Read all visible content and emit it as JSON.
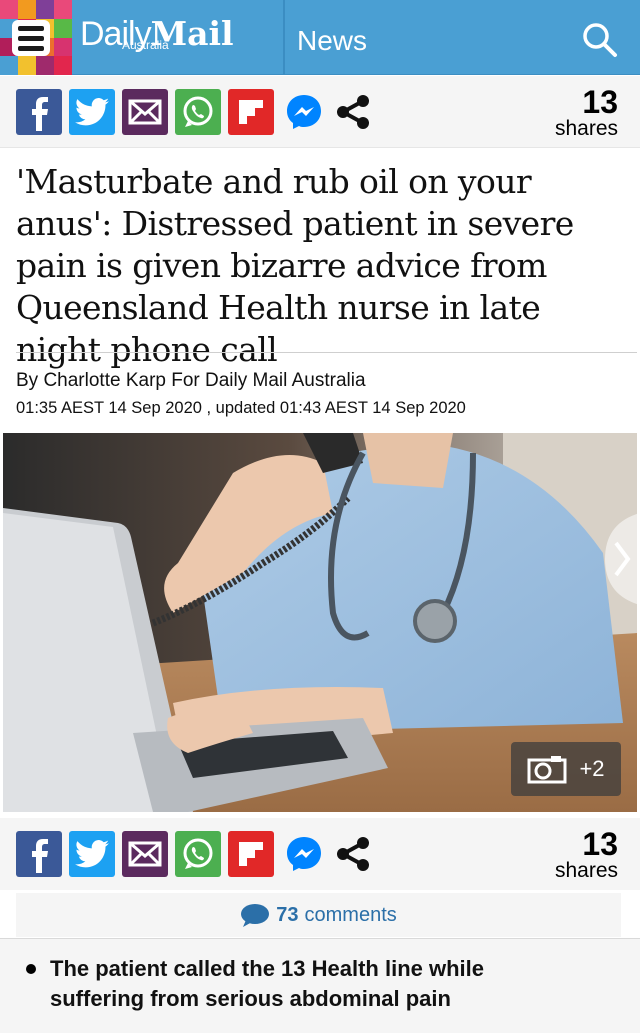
{
  "header": {
    "logo_daily": "Daily",
    "logo_mail": "Mail",
    "logo_edition": "Australia",
    "section": "News",
    "search_icon": "search-icon",
    "menu_icon": "hamburger-menu-icon",
    "colors": {
      "bar": "#4a9fd3"
    }
  },
  "share_bar_top": {
    "count": "13",
    "label": "shares",
    "buttons": [
      "facebook",
      "twitter",
      "email",
      "whatsapp",
      "flipboard",
      "messenger",
      "share"
    ]
  },
  "article": {
    "headline": "'Masturbate and rub oil on your anus': Distressed patient in severe pain is given bizarre advice from Queensland Health nurse in late night phone call",
    "byline": "By Charlotte Karp For Daily Mail Australia",
    "dateline": "01:35 AEST 14 Sep 2020 , updated 01:43 AEST 14 Sep 2020",
    "photo_more": "+2"
  },
  "share_bar_bottom": {
    "count": "13",
    "label": "shares"
  },
  "comments": {
    "count": "73",
    "label": "comments"
  },
  "bullets": [
    "The patient called the 13 Health line while suffering from serious abdominal pain"
  ],
  "colors": {
    "facebook": "#3b5998",
    "twitter": "#1da1f2",
    "email": "#5b2a5e",
    "whatsapp": "#4caf50",
    "flipboard": "#e12828",
    "messenger": "#0084ff",
    "link": "#2b6fa8"
  }
}
